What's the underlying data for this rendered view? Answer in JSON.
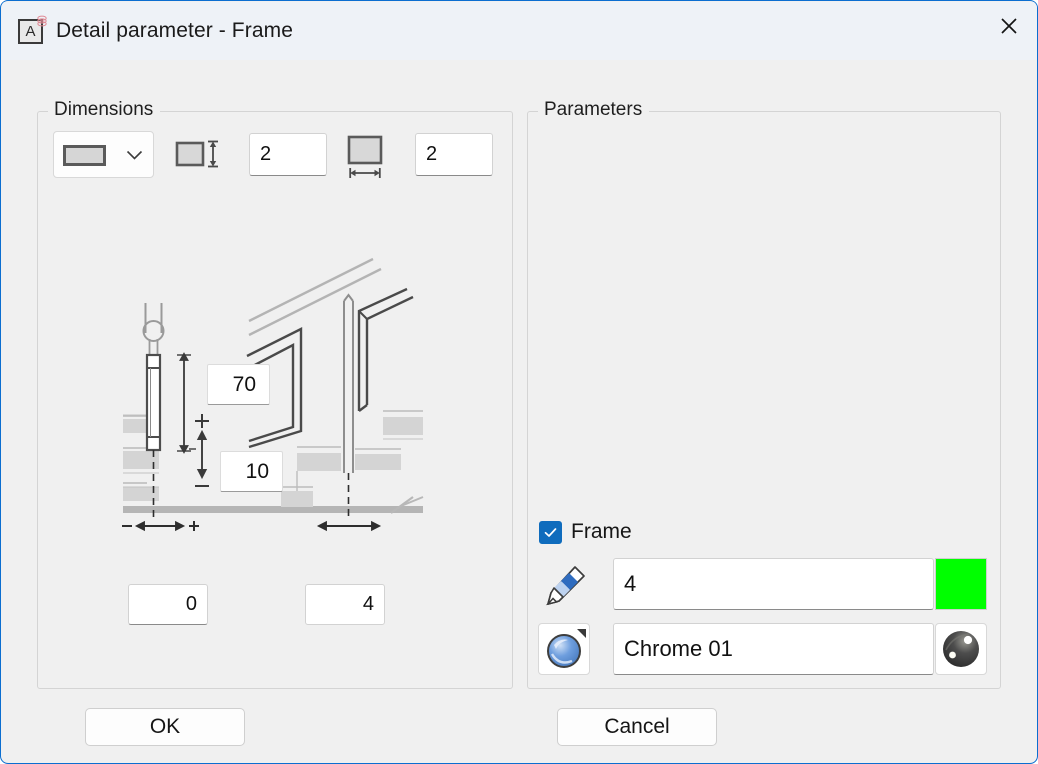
{
  "window": {
    "title": "Detail parameter - Frame",
    "app_icon_letter": "A",
    "app_icon_name": "archline-app-icon",
    "close_label": "✕",
    "accent_border": "#0b6ed0",
    "titlebar_bg": "#eef2f7",
    "body_bg": "#f0f0f0"
  },
  "dimensions": {
    "group_title": "Dimensions",
    "profile_select": {
      "name": "profile-shape-select",
      "selected_glyph": "rectangle-profile",
      "chevron": "chevron-down-icon"
    },
    "height_icon": "profile-height-icon",
    "height_value": "2",
    "width_icon": "profile-width-icon",
    "width_value": "2",
    "drawing": {
      "name": "frame-detail-drawing",
      "callout_top_value": "70",
      "callout_bottom_value": "10",
      "plus_marker": "+",
      "minus_marker": "−"
    },
    "offset_left_value": "0",
    "offset_right_value": "4"
  },
  "parameters": {
    "group_title": "Parameters",
    "frame_checkbox": {
      "label": "Frame",
      "checked": true,
      "check_glyph": "✓",
      "accent": "#0f6cbd"
    },
    "pen_row": {
      "icon": "pencil-icon",
      "value": "4",
      "color_swatch": "#00ff00",
      "color_swatch_name": "line-color-swatch"
    },
    "material_row": {
      "icon": "material-sphere-icon",
      "value": "Chrome 01",
      "preview_name": "material-preview-chrome"
    }
  },
  "footer": {
    "ok_label": "OK",
    "cancel_label": "Cancel"
  }
}
